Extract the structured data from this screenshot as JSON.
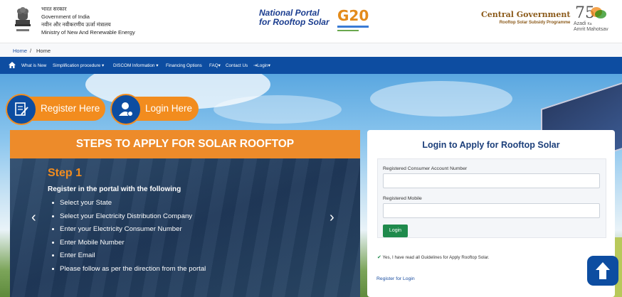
{
  "header": {
    "hindi_gov": "भारत सरकार",
    "gov": "Government of India",
    "hindi_ministry": "नवीन और नवीकरणीय ऊर्जा मंत्रालय",
    "ministry": "Ministry of New And Renewable Energy",
    "portal_line1": "National Portal",
    "portal_line2": "for Rooftop Solar",
    "g20": "G20",
    "central_gov": "Central Government",
    "programme": "Rooftop Solar Subsidy Programme",
    "amrit_line1": "Azadi",
    "amrit_ka": "Ka",
    "amrit_line2": "Amrit Mahotsav"
  },
  "breadcrumb": {
    "items": [
      "Home",
      "Home"
    ],
    "separator": "/"
  },
  "nav": {
    "items": [
      "What is New",
      "Simplification procedure",
      "DISCOM Information",
      "Financing Options",
      "FAQ",
      "Contact Us",
      "Login"
    ]
  },
  "hero": {
    "register_label": "Register Here",
    "login_label": "Login Here"
  },
  "steps": {
    "heading": "STEPS TO APPLY FOR SOLAR ROOFTOP",
    "step_title": "Step 1",
    "step_sub": "Register in the portal with the following",
    "items": [
      "Select your State",
      "Select your Electricity Distribution Company",
      "Enter your Electricity Consumer Number",
      "Enter Mobile Number",
      "Enter Email",
      "Please follow as per the direction from the portal"
    ]
  },
  "login_form": {
    "title": "Login to Apply for Rooftop Solar",
    "account_label": "Registered Consumer Account Number",
    "mobile_label": "Registered Mobile",
    "button": "Login",
    "agreement": "Yes, I have read all Guidelines for Apply Rooftop Solar.",
    "register_link": "Register for Login"
  },
  "colors": {
    "brand_blue": "#0d4da1",
    "accent_orange": "#f28c1e",
    "login_green": "#1f8a4c"
  }
}
